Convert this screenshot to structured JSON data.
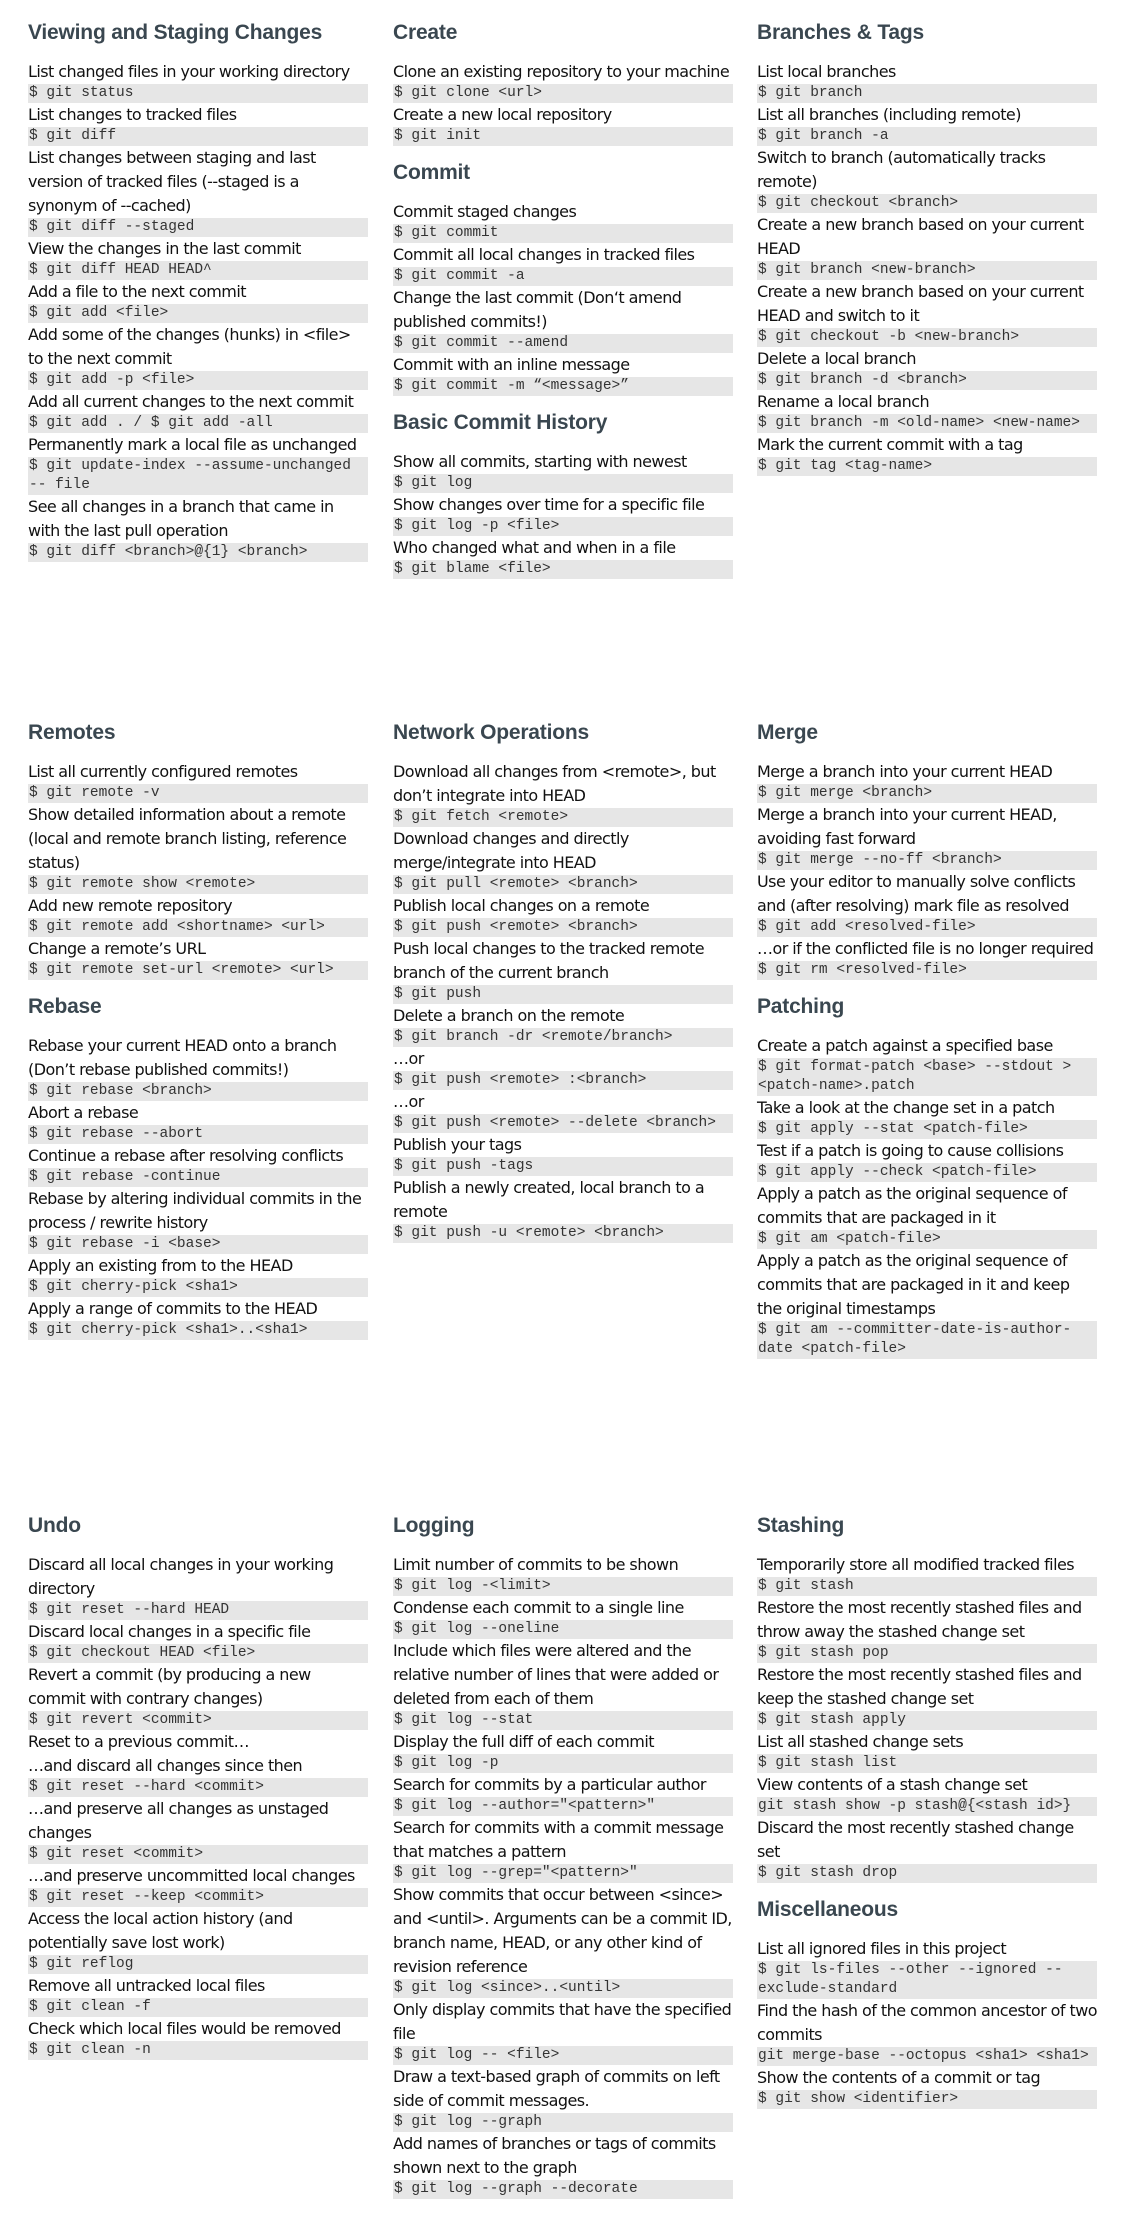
{
  "sections": [
    {
      "title": "Viewing and Staging Changes",
      "items": [
        {
          "type": "desc",
          "text": "List changed files in your working directory"
        },
        {
          "type": "cmd",
          "text": "$ git status"
        },
        {
          "type": "desc",
          "text": "List changes to tracked files"
        },
        {
          "type": "cmd",
          "text": "$ git diff"
        },
        {
          "type": "desc",
          "text": "List changes between staging and last version of tracked files (--staged is a synonym of --cached)"
        },
        {
          "type": "cmd",
          "text": "$ git diff --staged"
        },
        {
          "type": "desc",
          "text": "View the changes in the last commit"
        },
        {
          "type": "cmd",
          "text": "$ git diff HEAD HEAD^"
        },
        {
          "type": "desc",
          "text": "Add a file to the next commit"
        },
        {
          "type": "cmd",
          "text": "$ git add <file>"
        },
        {
          "type": "desc",
          "text": "Add some of the changes (hunks) in <file> to the next commit"
        },
        {
          "type": "cmd",
          "text": "$ git add -p <file>"
        },
        {
          "type": "desc",
          "text": "Add all current changes to the next commit"
        },
        {
          "type": "cmd",
          "text": "$ git add . / $ git add -all"
        },
        {
          "type": "desc",
          "text": "Permanently mark a local file as unchanged"
        },
        {
          "type": "cmd",
          "text": "$ git update-index --assume-unchanged -- file"
        },
        {
          "type": "desc",
          "text": "See all changes in a branch that came in with the last pull operation"
        },
        {
          "type": "cmd",
          "text": "$ git diff <branch>@{1} <branch>"
        }
      ]
    },
    {
      "title": "Create",
      "items": [
        {
          "type": "desc",
          "text": "Clone an existing repository to your machine"
        },
        {
          "type": "cmd",
          "text": "$ git clone <url>"
        },
        {
          "type": "desc",
          "text": "Create a new local repository"
        },
        {
          "type": "cmd",
          "text": "$ git init"
        }
      ]
    },
    {
      "title": "Commit",
      "items": [
        {
          "type": "desc",
          "text": "Commit staged changes"
        },
        {
          "type": "cmd",
          "text": "$ git commit"
        },
        {
          "type": "desc",
          "text": "Commit all local changes in tracked files"
        },
        {
          "type": "cmd",
          "text": "$ git commit -a"
        },
        {
          "type": "desc",
          "text": "Change the last commit (Don‘t amend published commits!)"
        },
        {
          "type": "cmd",
          "text": "$ git commit --amend"
        },
        {
          "type": "desc",
          "text": "Commit with an inline message"
        },
        {
          "type": "cmd",
          "text": "$ git commit -m “<message>”"
        }
      ]
    },
    {
      "title": "Basic Commit History",
      "items": [
        {
          "type": "desc",
          "text": "Show all commits, starting with newest"
        },
        {
          "type": "cmd",
          "text": "$ git log"
        },
        {
          "type": "desc",
          "text": "Show changes over time for a specific file"
        },
        {
          "type": "cmd",
          "text": "$ git log -p <file>"
        },
        {
          "type": "desc",
          "text": "Who changed what and when in a file"
        },
        {
          "type": "cmd",
          "text": "$ git blame <file>"
        }
      ]
    },
    {
      "title": "Branches & Tags",
      "items": [
        {
          "type": "desc",
          "text": "List local branches"
        },
        {
          "type": "cmd",
          "text": "$ git branch"
        },
        {
          "type": "desc",
          "text": "List all branches (including remote)"
        },
        {
          "type": "cmd",
          "text": "$ git branch -a"
        },
        {
          "type": "desc",
          "text": "Switch to branch (automatically tracks remote)"
        },
        {
          "type": "cmd",
          "text": "$ git checkout <branch>"
        },
        {
          "type": "desc",
          "text": "Create a new branch based on your current HEAD"
        },
        {
          "type": "cmd",
          "text": "$ git branch <new-branch>"
        },
        {
          "type": "desc",
          "text": "Create a new branch based on your current HEAD and switch to it"
        },
        {
          "type": "cmd",
          "text": "$ git checkout -b <new-branch>"
        },
        {
          "type": "desc",
          "text": "Delete a local branch"
        },
        {
          "type": "cmd",
          "text": "$ git branch -d <branch>"
        },
        {
          "type": "desc",
          "text": "Rename a local branch"
        },
        {
          "type": "cmd",
          "text": "$ git branch -m <old-name> <new-name>"
        },
        {
          "type": "desc",
          "text": "Mark the current commit with a tag"
        },
        {
          "type": "cmd",
          "text": "$ git tag <tag-name>"
        }
      ]
    },
    {
      "title": "Remotes",
      "items": [
        {
          "type": "desc",
          "text": "List all currently configured remotes"
        },
        {
          "type": "cmd",
          "text": "$ git remote -v"
        },
        {
          "type": "desc",
          "text": "Show detailed information about a remote (local and remote branch listing, reference status)"
        },
        {
          "type": "cmd",
          "text": "$ git remote show <remote>"
        },
        {
          "type": "desc",
          "text": "Add new remote repository"
        },
        {
          "type": "cmd",
          "text": "$ git remote add <shortname> <url>"
        },
        {
          "type": "desc",
          "text": "Change a remote’s URL"
        },
        {
          "type": "cmd",
          "text": "$ git remote set-url <remote> <url>"
        }
      ]
    },
    {
      "title": "Rebase",
      "items": [
        {
          "type": "desc",
          "text": "Rebase your current HEAD onto a branch (Don’t rebase published commits!)"
        },
        {
          "type": "cmd",
          "text": "$ git rebase <branch>"
        },
        {
          "type": "desc",
          "text": "Abort a rebase"
        },
        {
          "type": "cmd",
          "text": "$ git rebase --abort"
        },
        {
          "type": "desc",
          "text": "Continue a rebase after resolving conflicts"
        },
        {
          "type": "cmd",
          "text": "$ git rebase -continue"
        },
        {
          "type": "desc",
          "text": "Rebase by altering individual commits in the process / rewrite history"
        },
        {
          "type": "cmd",
          "text": "$ git rebase -i <base>"
        },
        {
          "type": "desc",
          "text": "Apply an existing from to the HEAD"
        },
        {
          "type": "cmd",
          "text": "$ git cherry-pick <sha1>"
        },
        {
          "type": "desc",
          "text": "Apply a range of commits to the HEAD"
        },
        {
          "type": "cmd",
          "text": "$ git cherry-pick <sha1>..<sha1>"
        }
      ]
    },
    {
      "title": "Network Operations",
      "items": [
        {
          "type": "desc",
          "text": "Download all changes from <remote>, but don’t integrate into HEAD"
        },
        {
          "type": "cmd",
          "text": "$ git fetch <remote>"
        },
        {
          "type": "desc",
          "text": "Download changes and directly merge/integrate into HEAD"
        },
        {
          "type": "cmd",
          "text": "$ git pull <remote> <branch>"
        },
        {
          "type": "desc",
          "text": "Publish local changes on a remote"
        },
        {
          "type": "cmd",
          "text": "$ git push <remote> <branch>"
        },
        {
          "type": "desc",
          "text": "Push local changes to the tracked remote branch of the current branch"
        },
        {
          "type": "cmd",
          "text": "$ git push"
        },
        {
          "type": "desc",
          "text": "Delete a branch on the remote"
        },
        {
          "type": "cmd",
          "text": "$ git branch -dr <remote/branch>"
        },
        {
          "type": "desc",
          "text": "…or"
        },
        {
          "type": "cmd",
          "text": "$ git push <remote> :<branch>"
        },
        {
          "type": "desc",
          "text": "…or"
        },
        {
          "type": "cmd",
          "text": "$ git push <remote> --delete <branch>"
        },
        {
          "type": "desc",
          "text": "Publish your tags"
        },
        {
          "type": "cmd",
          "text": "$ git push -tags"
        },
        {
          "type": "desc",
          "text": "Publish a newly created, local branch to a remote"
        },
        {
          "type": "cmd",
          "text": "$ git push -u <remote> <branch>"
        }
      ]
    },
    {
      "title": "Merge",
      "items": [
        {
          "type": "desc",
          "text": "Merge a branch into your current HEAD"
        },
        {
          "type": "cmd",
          "text": "$ git merge <branch>"
        },
        {
          "type": "desc",
          "text": "Merge a branch into your current HEAD, avoiding fast forward"
        },
        {
          "type": "cmd",
          "text": "$ git merge --no-ff <branch>"
        },
        {
          "type": "desc",
          "text": "Use your editor to manually solve conflicts and (after resolving) mark file as resolved"
        },
        {
          "type": "cmd",
          "text": "$ git add <resolved-file>"
        },
        {
          "type": "desc",
          "text": "…or if the conflicted file is no longer required"
        },
        {
          "type": "cmd",
          "text": "$ git rm <resolved-file>"
        }
      ]
    },
    {
      "title": "Patching",
      "items": [
        {
          "type": "desc",
          "text": "Create a patch against a specified base"
        },
        {
          "type": "cmd",
          "text": "$ git format-patch <base> --stdout > <patch-name>.patch"
        },
        {
          "type": "desc",
          "text": "Take a look at the change set in a patch"
        },
        {
          "type": "cmd",
          "text": "$ git apply --stat <patch-file>"
        },
        {
          "type": "desc",
          "text": "Test if a patch is going to cause collisions"
        },
        {
          "type": "cmd",
          "text": "$ git apply --check <patch-file>"
        },
        {
          "type": "desc",
          "text": "Apply a patch as the original sequence of commits that are packaged in it"
        },
        {
          "type": "cmd",
          "text": "$ git am <patch-file>"
        },
        {
          "type": "desc",
          "text": "Apply a patch as the original sequence of commits that are packaged in it and keep the original timestamps"
        },
        {
          "type": "cmd",
          "text": "$ git am --committer-date-is-author-date <patch-file>"
        }
      ]
    },
    {
      "title": "Undo",
      "items": [
        {
          "type": "desc",
          "text": "Discard all local changes in your working directory"
        },
        {
          "type": "cmd",
          "text": "$ git reset --hard HEAD"
        },
        {
          "type": "desc",
          "text": "Discard local changes in a specific file"
        },
        {
          "type": "cmd",
          "text": "$ git checkout HEAD <file>"
        },
        {
          "type": "desc",
          "text": "Revert a commit (by producing a new commit with contrary changes)"
        },
        {
          "type": "cmd",
          "text": "$ git revert <commit>"
        },
        {
          "type": "desc",
          "text": "Reset to a previous commit…"
        },
        {
          "type": "desc",
          "text": "…and discard all changes since then"
        },
        {
          "type": "cmd",
          "text": "$ git reset --hard <commit>"
        },
        {
          "type": "desc",
          "text": "…and preserve all changes as unstaged changes"
        },
        {
          "type": "cmd",
          "text": "$ git reset <commit>"
        },
        {
          "type": "desc",
          "text": "…and preserve uncommitted local changes"
        },
        {
          "type": "cmd",
          "text": "$ git reset --keep <commit>"
        },
        {
          "type": "desc",
          "text": "Access the local action history (and potentially save lost work)"
        },
        {
          "type": "cmd",
          "text": "$ git reflog"
        },
        {
          "type": "desc",
          "text": "Remove all untracked local files"
        },
        {
          "type": "cmd",
          "text": "$ git clean -f"
        },
        {
          "type": "desc",
          "text": "Check which local files would be removed"
        },
        {
          "type": "cmd",
          "text": "$ git clean -n"
        }
      ]
    },
    {
      "title": "Logging",
      "items": [
        {
          "type": "desc",
          "text": "Limit number of commits to be shown"
        },
        {
          "type": "cmd",
          "text": "$ git log -<limit>"
        },
        {
          "type": "desc",
          "text": "Condense each commit to a single line"
        },
        {
          "type": "cmd",
          "text": "$ git log --oneline"
        },
        {
          "type": "desc",
          "text": "Include which files were altered and the relative number of lines that were added or deleted from each of them"
        },
        {
          "type": "cmd",
          "text": "$ git log --stat"
        },
        {
          "type": "desc",
          "text": "Display the full diff of each commit"
        },
        {
          "type": "cmd",
          "text": "$ git log -p"
        },
        {
          "type": "desc",
          "text": "Search for commits by a particular author"
        },
        {
          "type": "cmd",
          "text": "$ git log --author=\"<pattern>\""
        },
        {
          "type": "desc",
          "text": "Search for commits with a commit message that matches a pattern"
        },
        {
          "type": "cmd",
          "text": "$ git log --grep=\"<pattern>\""
        },
        {
          "type": "desc",
          "text": "Show commits that occur between <since> and <until>. Arguments can be a commit ID, branch name, HEAD, or any other kind of revision reference"
        },
        {
          "type": "cmd",
          "text": "$ git log <since>..<until>"
        },
        {
          "type": "desc",
          "text": "Only display commits that have the specified file"
        },
        {
          "type": "cmd",
          "text": "$ git log -- <file>"
        },
        {
          "type": "desc",
          "text": "Draw a text-based graph of commits on left side of commit messages."
        },
        {
          "type": "cmd",
          "text": "$ git log --graph"
        },
        {
          "type": "desc",
          "text": "Add names of branches or tags of commits shown next to the graph"
        },
        {
          "type": "cmd",
          "text": "$ git log --graph --decorate"
        }
      ]
    },
    {
      "title": "Stashing",
      "items": [
        {
          "type": "desc",
          "text": "Temporarily store all modified tracked files"
        },
        {
          "type": "cmd",
          "text": "$ git stash"
        },
        {
          "type": "desc",
          "text": "Restore the most recently stashed files and throw away the stashed change set"
        },
        {
          "type": "cmd",
          "text": "$ git stash pop"
        },
        {
          "type": "desc",
          "text": "Restore the most recently stashed files and keep the stashed change set"
        },
        {
          "type": "cmd",
          "text": "$ git stash apply"
        },
        {
          "type": "desc",
          "text": "List all stashed change sets"
        },
        {
          "type": "cmd",
          "text": "$ git stash list"
        },
        {
          "type": "desc",
          "text": "View contents of a stash change set"
        },
        {
          "type": "cmd",
          "text": "git stash show -p stash@{<stash id>}"
        },
        {
          "type": "desc",
          "text": "Discard the most recently stashed change set"
        },
        {
          "type": "cmd",
          "text": "$ git stash drop"
        }
      ]
    },
    {
      "title": "Miscellaneous",
      "items": [
        {
          "type": "desc",
          "text": "List all ignored files in this project"
        },
        {
          "type": "cmd",
          "text": "$ git ls-files --other --ignored --exclude-standard"
        },
        {
          "type": "desc",
          "text": "Find the hash of the common ancestor of two commits"
        },
        {
          "type": "cmd",
          "text": "git merge-base --octopus <sha1> <sha1>"
        },
        {
          "type": "desc",
          "text": "Show the contents of a commit or tag"
        },
        {
          "type": "cmd",
          "text": "$ git show <identifier>"
        }
      ]
    }
  ]
}
